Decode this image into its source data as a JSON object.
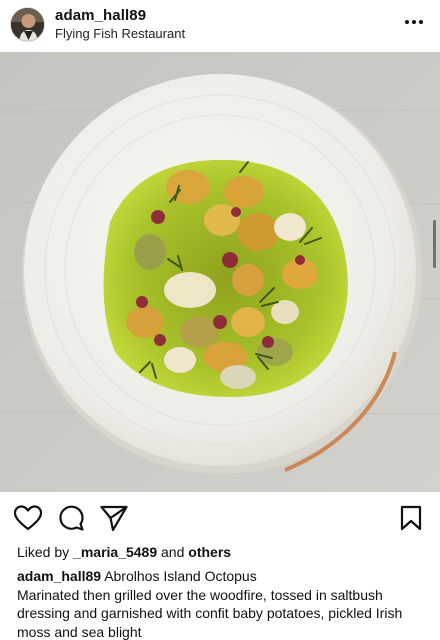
{
  "post": {
    "username": "adam_hall89",
    "location": "Flying Fish Restaurant",
    "likes_prefix": "Liked by",
    "liked_by_user": "_maria_5489",
    "likes_and": "and",
    "likes_others": "others",
    "caption_title": "Abrolhos Island Octopus",
    "caption_body": "Marinated then grilled over the woodfire, tossed in saltbush dressing and garnished with confit baby potatoes, pickled Irish moss and sea blight"
  },
  "icons": {
    "more": "more-options-icon",
    "like": "heart-icon",
    "comment": "comment-bubble-icon",
    "share": "paper-plane-icon",
    "save": "bookmark-icon"
  },
  "colors": {
    "text": "#111111",
    "sauce": "#b6c92c",
    "plate": "#f1efe8",
    "table": "#c9c7c2"
  }
}
